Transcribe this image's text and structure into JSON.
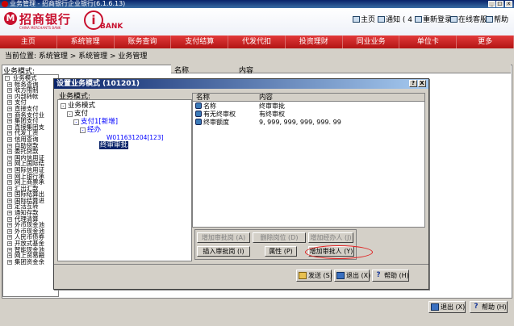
{
  "window": {
    "title": "业务管理 - 招商银行企业银行(6.1.6.13)"
  },
  "brand": {
    "logo_cn": "招商银行",
    "logo_en": "CHINA MERCHANTS BANK",
    "logo_mark": "M",
    "ibank_mark": "i",
    "ibank_label": "BANK"
  },
  "toplinks": [
    {
      "label": "主页"
    },
    {
      "label": "通知 ( 4 )"
    },
    {
      "label": "重新登录"
    },
    {
      "label": "在线客服"
    },
    {
      "label": "帮助"
    }
  ],
  "mainnav": [
    "主页",
    "系统管理",
    "账务查询",
    "支付结算",
    "代发代扣",
    "投资理财",
    "同业业务",
    "单位卡",
    "更多"
  ],
  "breadcrumb": "当前位置: 系统管理 > 系统管理 > 业务管理",
  "bg": {
    "left_label": "业务模式:",
    "right_headers": {
      "name": "名称",
      "content": "内容"
    },
    "tree": {
      "root": "业务模式",
      "items": [
        "帐务查询",
        "收方限制",
        "内部转帐",
        "支付",
        "直接支付",
        "商务支付业",
        "集团支付",
        "直接集团支",
        "代发工资",
        "信用查询",
        "自助贷款",
        "委托贷款",
        "国内信用证",
        "网上国际结",
        "国际信用证",
        "网上银行承",
        "网上商票承",
        "汇出汇款",
        "国际结算出",
        "国际结算进",
        "定活互转",
        "通知存款",
        "代理清算",
        "外币现金池",
        "外币现金池",
        "人民币债券",
        "开放式基金",
        "智能现金池",
        "网上贸易融",
        "集团资金余"
      ]
    }
  },
  "dialog": {
    "title": "设置业务模式 (101201)",
    "help_btn": "?",
    "close_btn": "X",
    "tree_label": "业务模式:",
    "tree": {
      "root": "业务模式",
      "pay": "支付",
      "pay1": "支付1[新增]",
      "handler": "经办",
      "account": "W011631204[123]",
      "approver": "终审审批"
    },
    "grid_headers": {
      "name": "名称",
      "content": "内容"
    },
    "rows": [
      {
        "name": "名称",
        "value": "终审审批"
      },
      {
        "name": "有无终审权",
        "value": "有终审权"
      },
      {
        "name": "终审额度",
        "value": "9, 999, 999, 999, 999. 99"
      }
    ],
    "buttons": {
      "add_post": "增加审批岗 (A)",
      "delete_post": "删除岗位 (D)",
      "add_handler": "增加经办人 (J)",
      "insert_post": "插入审批岗 (I)",
      "attribute": "属性 (P)",
      "add_approver": "增加审批人 (Y)"
    },
    "bottom": {
      "send": "发送 (S)",
      "exit": "退出 (X)",
      "help": "帮助 (H)"
    }
  },
  "footer": {
    "exit": "退出 (X)",
    "help": "帮助 (H)"
  }
}
